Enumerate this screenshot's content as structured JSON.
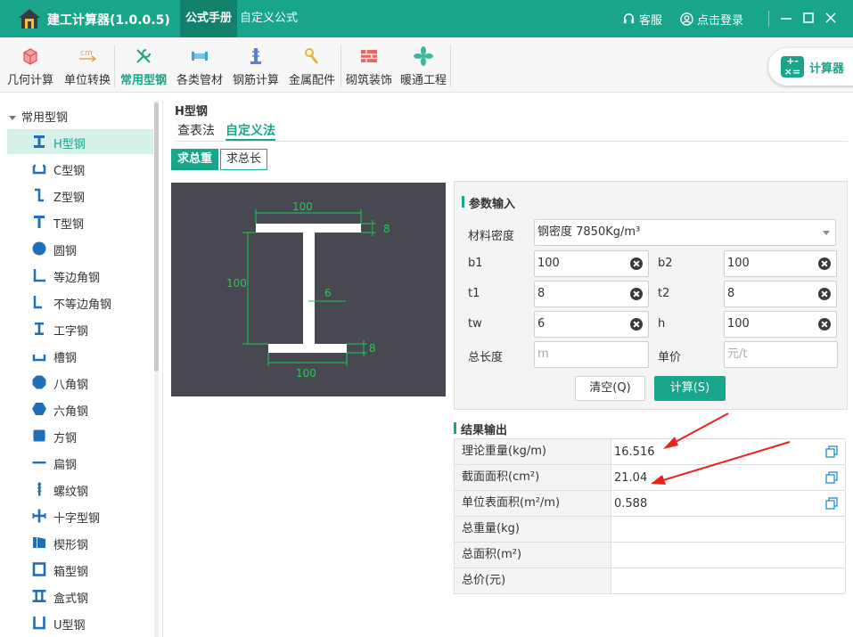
{
  "titlebar": {
    "app_title": "建工计算器(1.0.0.5)",
    "tabs": [
      {
        "label": "公式手册",
        "active": true
      },
      {
        "label": "自定义公式",
        "active": false
      }
    ],
    "service_label": "客服",
    "login_label": "点击登录",
    "accent_color": "#19a58a"
  },
  "toolbar": {
    "items": [
      {
        "label": "几何计算",
        "icon": "cube-icon"
      },
      {
        "label": "单位转换",
        "icon": "cm-unit-icon"
      },
      {
        "label": "常用型钢",
        "icon": "wrench-icon",
        "active": true
      },
      {
        "label": "各类管材",
        "icon": "pipe-icon"
      },
      {
        "label": "钢筋计算",
        "icon": "rebar-icon"
      },
      {
        "label": "金属配件",
        "icon": "metal-fitting-icon"
      },
      {
        "label": "砌筑装饰",
        "icon": "brick-icon"
      },
      {
        "label": "暖通工程",
        "icon": "fan-icon"
      }
    ],
    "calculator_label": "计算器"
  },
  "sidebar": {
    "group_label": "常用型钢",
    "items": [
      {
        "label": "H型钢",
        "icon": "h-beam-icon",
        "active": true
      },
      {
        "label": "C型钢",
        "icon": "c-channel-icon"
      },
      {
        "label": "Z型钢",
        "icon": "z-section-icon"
      },
      {
        "label": "T型钢",
        "icon": "t-section-icon"
      },
      {
        "label": "圆钢",
        "icon": "round-bar-icon"
      },
      {
        "label": "等边角钢",
        "icon": "equal-angle-icon"
      },
      {
        "label": "不等边角钢",
        "icon": "unequal-angle-icon"
      },
      {
        "label": "工字钢",
        "icon": "i-beam-icon"
      },
      {
        "label": "槽钢",
        "icon": "channel-icon"
      },
      {
        "label": "八角钢",
        "icon": "octagon-bar-icon"
      },
      {
        "label": "六角钢",
        "icon": "hexagon-bar-icon"
      },
      {
        "label": "方钢",
        "icon": "square-bar-icon"
      },
      {
        "label": "扁钢",
        "icon": "flat-bar-icon"
      },
      {
        "label": "螺纹钢",
        "icon": "threaded-bar-icon"
      },
      {
        "label": "十字型钢",
        "icon": "cross-section-icon"
      },
      {
        "label": "楔形钢",
        "icon": "wedge-section-icon"
      },
      {
        "label": "箱型钢",
        "icon": "box-section-icon"
      },
      {
        "label": "盒式钢",
        "icon": "box-type-icon"
      },
      {
        "label": "U型钢",
        "icon": "u-section-icon"
      }
    ]
  },
  "main": {
    "section_title": "H型钢",
    "method_tabs": [
      {
        "label": "查表法",
        "active": false
      },
      {
        "label": "自定义法",
        "active": true
      }
    ],
    "mode_buttons": [
      {
        "label": "求总重",
        "active": true
      },
      {
        "label": "求总长",
        "active": false
      }
    ],
    "diagram": {
      "top_flange_width": "100",
      "top_flange_thickness": "8",
      "height": "100",
      "web_thickness": "6",
      "bottom_flange_thickness": "8",
      "bottom_flange_width": "100",
      "dimension_color": "#19d14a"
    }
  },
  "params": {
    "title": "参数输入",
    "density_label": "材料密度",
    "density_value": "钢密度 7850Kg/m³",
    "b1_label": "b1",
    "b1_value": "100",
    "b2_label": "b2",
    "b2_value": "100",
    "t1_label": "t1",
    "t1_value": "8",
    "t2_label": "t2",
    "t2_value": "8",
    "tw_label": "tw",
    "tw_value": "6",
    "h_label": "h",
    "h_value": "100",
    "length_label": "总长度",
    "length_placeholder": "m",
    "price_label": "单价",
    "price_placeholder": "元/t",
    "clear_button": "清空(Q)",
    "calc_button": "计算(S)"
  },
  "results": {
    "title": "结果输出",
    "rows": [
      {
        "label": "理论重量(kg/m)",
        "value": "16.516",
        "copy": true
      },
      {
        "label": "截面面积(cm²)",
        "value": "21.04",
        "copy": true
      },
      {
        "label": "单位表面积(m²/m)",
        "value": "0.588",
        "copy": true
      },
      {
        "label": "总重量(kg)",
        "value": "",
        "copy": false
      },
      {
        "label": "总面积(m²)",
        "value": "",
        "copy": false
      },
      {
        "label": "总价(元)",
        "value": "",
        "copy": false
      }
    ],
    "annotation_arrow_color": "#e8231b"
  }
}
